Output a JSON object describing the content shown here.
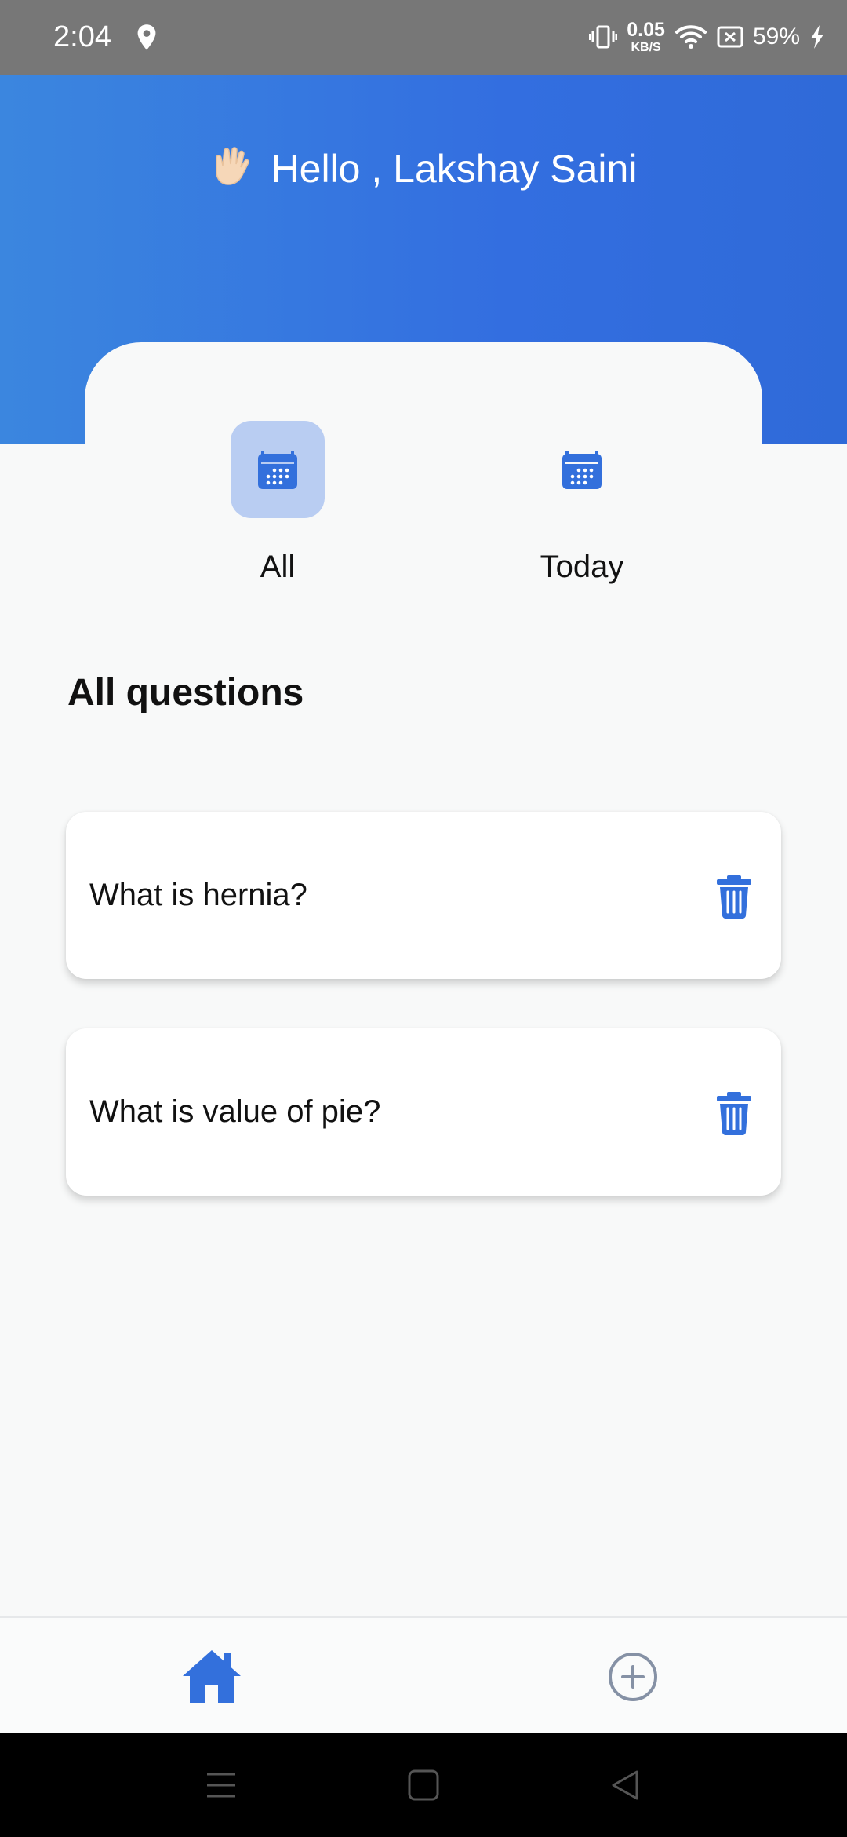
{
  "status_bar": {
    "time": "2:04",
    "net_speed_value": "0.05",
    "net_speed_unit": "KB/S",
    "battery": "59%"
  },
  "header": {
    "greeting": "Hello , Lakshay Saini"
  },
  "filters": {
    "all_label": "All",
    "today_label": "Today",
    "selected": "All"
  },
  "section": {
    "title": "All questions"
  },
  "questions": [
    {
      "text": "What is hernia?"
    },
    {
      "text": "What is value of pie?"
    }
  ],
  "colors": {
    "accent": "#3370dc",
    "header_gradient_start": "#3b86df",
    "header_gradient_end": "#2f6ad8",
    "selected_filter_bg": "#b9cdf2",
    "background": "#f8f9f9"
  },
  "icons": {
    "status": [
      "location-icon",
      "vibrate-icon",
      "wifi-icon",
      "battery-saver-icon",
      "charging-icon"
    ],
    "header": "waving-hand-icon",
    "filters": "calendar-icon",
    "question_action": "trash-icon",
    "bottom_nav": [
      "home-icon",
      "add-circle-icon"
    ],
    "system_nav": [
      "menu-icon",
      "home-square-icon",
      "back-icon"
    ]
  }
}
